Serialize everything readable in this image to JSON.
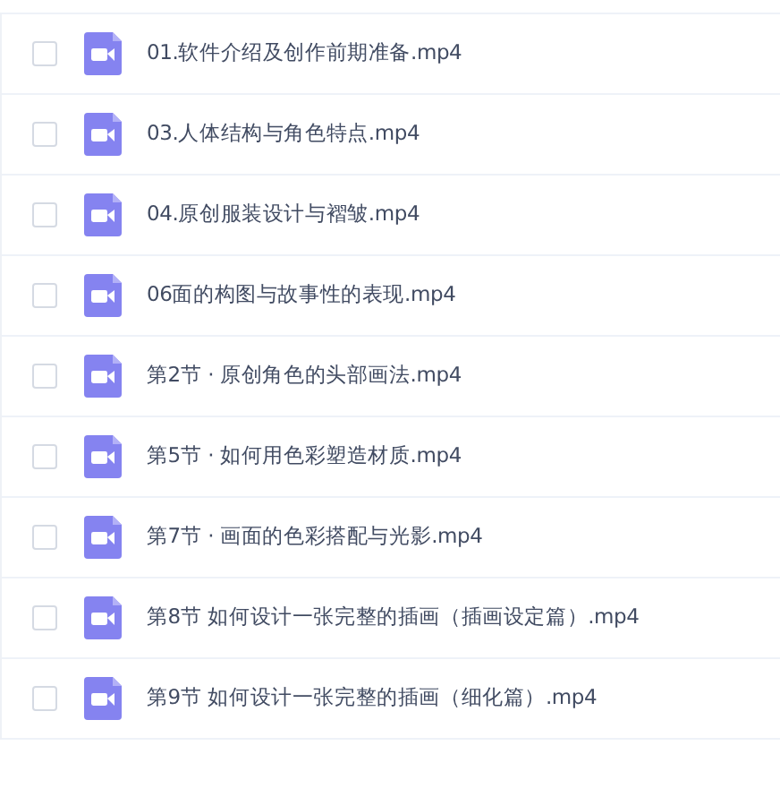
{
  "files": [
    {
      "name": "01.软件介绍及创作前期准备.mp4",
      "checked": false
    },
    {
      "name": "03.人体结构与角色特点.mp4",
      "checked": false
    },
    {
      "name": "04.原创服装设计与褶皱.mp4",
      "checked": false
    },
    {
      "name": "06面的构图与故事性的表现.mp4",
      "checked": false
    },
    {
      "name": "第2节 · 原创角色的头部画法.mp4",
      "checked": false
    },
    {
      "name": "第5节 · 如何用色彩塑造材质.mp4",
      "checked": false
    },
    {
      "name": "第7节 · 画面的色彩搭配与光影.mp4",
      "checked": false
    },
    {
      "name": "第8节 如何设计一张完整的插画（插画设定篇）.mp4",
      "checked": false
    },
    {
      "name": "第9节 如何设计一张完整的插画（细化篇）.mp4",
      "checked": false
    }
  ]
}
